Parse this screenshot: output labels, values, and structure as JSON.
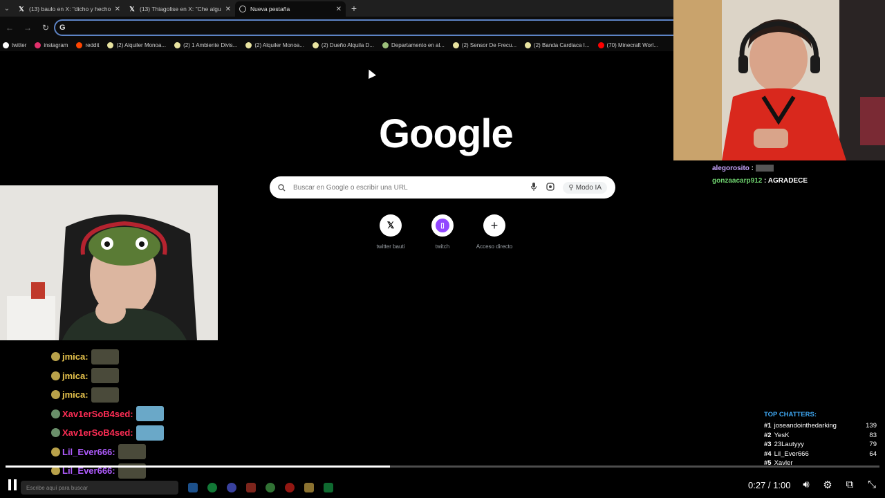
{
  "browser": {
    "tabs": [
      {
        "title": "(13) baulo en X: \"dicho y hecho",
        "icon": "x-logo-icon",
        "active": false
      },
      {
        "title": "(13) Thiagolise en X: \"Che algu",
        "icon": "x-logo-icon",
        "active": false
      },
      {
        "title": "Nueva pestaña",
        "icon": "chrome-icon",
        "active": true
      }
    ],
    "new_tab_label": "+",
    "omnibox": {
      "value": "",
      "prefix": "G"
    },
    "bookmarks": [
      {
        "label": "twitter",
        "color": "#ffffff"
      },
      {
        "label": "instagram",
        "color": "#e1306c"
      },
      {
        "label": "reddit",
        "color": "#ff4500"
      },
      {
        "label": "(2) Alquiler Monoa...",
        "color": "#e8e3a0"
      },
      {
        "label": "(2) 1 Ambiente Divis...",
        "color": "#e8e3a0"
      },
      {
        "label": "(2) Alquiler Monoa...",
        "color": "#e8e3a0"
      },
      {
        "label": "(2) Dueño Alquila D...",
        "color": "#e8e3a0"
      },
      {
        "label": "Departamento en al...",
        "color": "#9cbf7b"
      },
      {
        "label": "(2) Sensor De Frecu...",
        "color": "#e8e3a0"
      },
      {
        "label": "(2) Banda Cardiaca I...",
        "color": "#e8e3a0"
      },
      {
        "label": "(70) Minecraft Worl...",
        "color": "#ff0000"
      }
    ]
  },
  "google": {
    "logo": "Google",
    "search_placeholder": "Buscar en Google o escribir una URL",
    "ai_mode": "Modo IA",
    "shortcuts": [
      {
        "label": "twitter bauti",
        "glyph": "X",
        "color": "#000000"
      },
      {
        "label": "twitch",
        "glyph": "t",
        "color": "#9146ff"
      },
      {
        "label": "Acceso directo",
        "glyph": "+",
        "color": "#202124"
      }
    ]
  },
  "chat_top": [
    {
      "user": "alegorosito",
      "message": "",
      "color": "#c9a6ff"
    },
    {
      "user": "gonzaacarp912",
      "message": "AGRADECE",
      "color": "#6fd36f"
    }
  ],
  "chat_left": [
    {
      "user": "jmica",
      "color": "#e8c44d",
      "badge": "#b8a14a"
    },
    {
      "user": "jmica",
      "color": "#e8c44d",
      "badge": "#b8a14a"
    },
    {
      "user": "jmica",
      "color": "#e8c44d",
      "badge": "#b8a14a"
    },
    {
      "user": "Xav1erSoB4sed",
      "color": "#ff2d55",
      "badge": "#6a8f6a"
    },
    {
      "user": "Xav1erSoB4sed",
      "color": "#ff2d55",
      "badge": "#6a8f6a"
    },
    {
      "user": "Lil_Ever666",
      "color": "#b05cff",
      "badge": "#b8a14a"
    },
    {
      "user": "Lil_Ever666",
      "color": "#b05cff",
      "badge": "#b8a14a"
    }
  ],
  "top_chatters": {
    "title": "TOP CHATTERS:",
    "rows": [
      {
        "rank": "#1",
        "name": "joseandointhedarking",
        "count": "139"
      },
      {
        "rank": "#2",
        "name": "YesK",
        "count": "83"
      },
      {
        "rank": "#3",
        "name": "23Lautyyy",
        "count": "79"
      },
      {
        "rank": "#4",
        "name": "Lil_Ever666",
        "count": "64"
      },
      {
        "rank": "#5",
        "name": "Xavler",
        "count": ""
      }
    ]
  },
  "player": {
    "time": "0:27 / 1:00",
    "progress": 0.44,
    "taskbar_search": "Escribe aquí para buscar"
  }
}
